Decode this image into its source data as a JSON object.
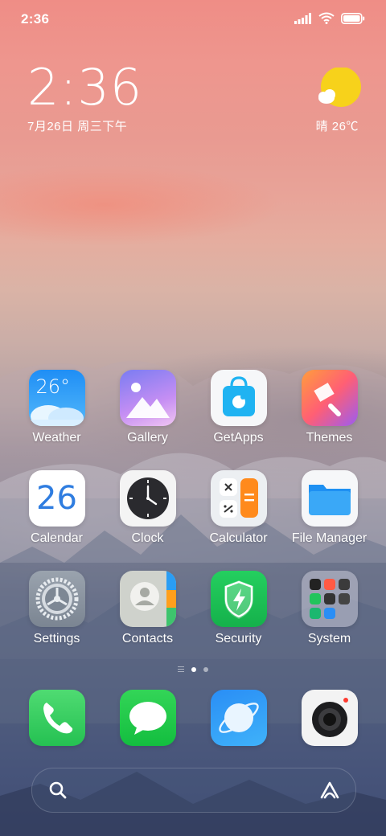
{
  "status_bar": {
    "time": "2:36"
  },
  "clock_widget": {
    "time": "2:36",
    "date": "7月26日 周三下午"
  },
  "weather_widget": {
    "text": "晴 26℃"
  },
  "apps": {
    "row1": [
      {
        "label": "Weather",
        "icon": "weather-icon"
      },
      {
        "label": "Gallery",
        "icon": "gallery-icon"
      },
      {
        "label": "GetApps",
        "icon": "getapps-icon"
      },
      {
        "label": "Themes",
        "icon": "themes-icon"
      }
    ],
    "row2": [
      {
        "label": "Calendar",
        "icon": "calendar-icon"
      },
      {
        "label": "Clock",
        "icon": "clock-icon"
      },
      {
        "label": "Calculator",
        "icon": "calculator-icon"
      },
      {
        "label": "File Manager",
        "icon": "folder-icon"
      }
    ],
    "row3": [
      {
        "label": "Settings",
        "icon": "gear-icon"
      },
      {
        "label": "Contacts",
        "icon": "contacts-icon"
      },
      {
        "label": "Security",
        "icon": "shield-icon"
      },
      {
        "label": "System",
        "icon": "folder-grid-icon"
      }
    ]
  },
  "weather_icon_temp": "26°",
  "calendar_icon_day": "26",
  "page_indicator": {
    "pages": 2,
    "active_page": 1
  },
  "dock": [
    "phone-icon",
    "messages-icon",
    "browser-icon",
    "camera-icon"
  ],
  "colors": {
    "sun": "#f7d21b",
    "security_green": "#1dbf54",
    "calc_orange": "#ff8a1c"
  }
}
